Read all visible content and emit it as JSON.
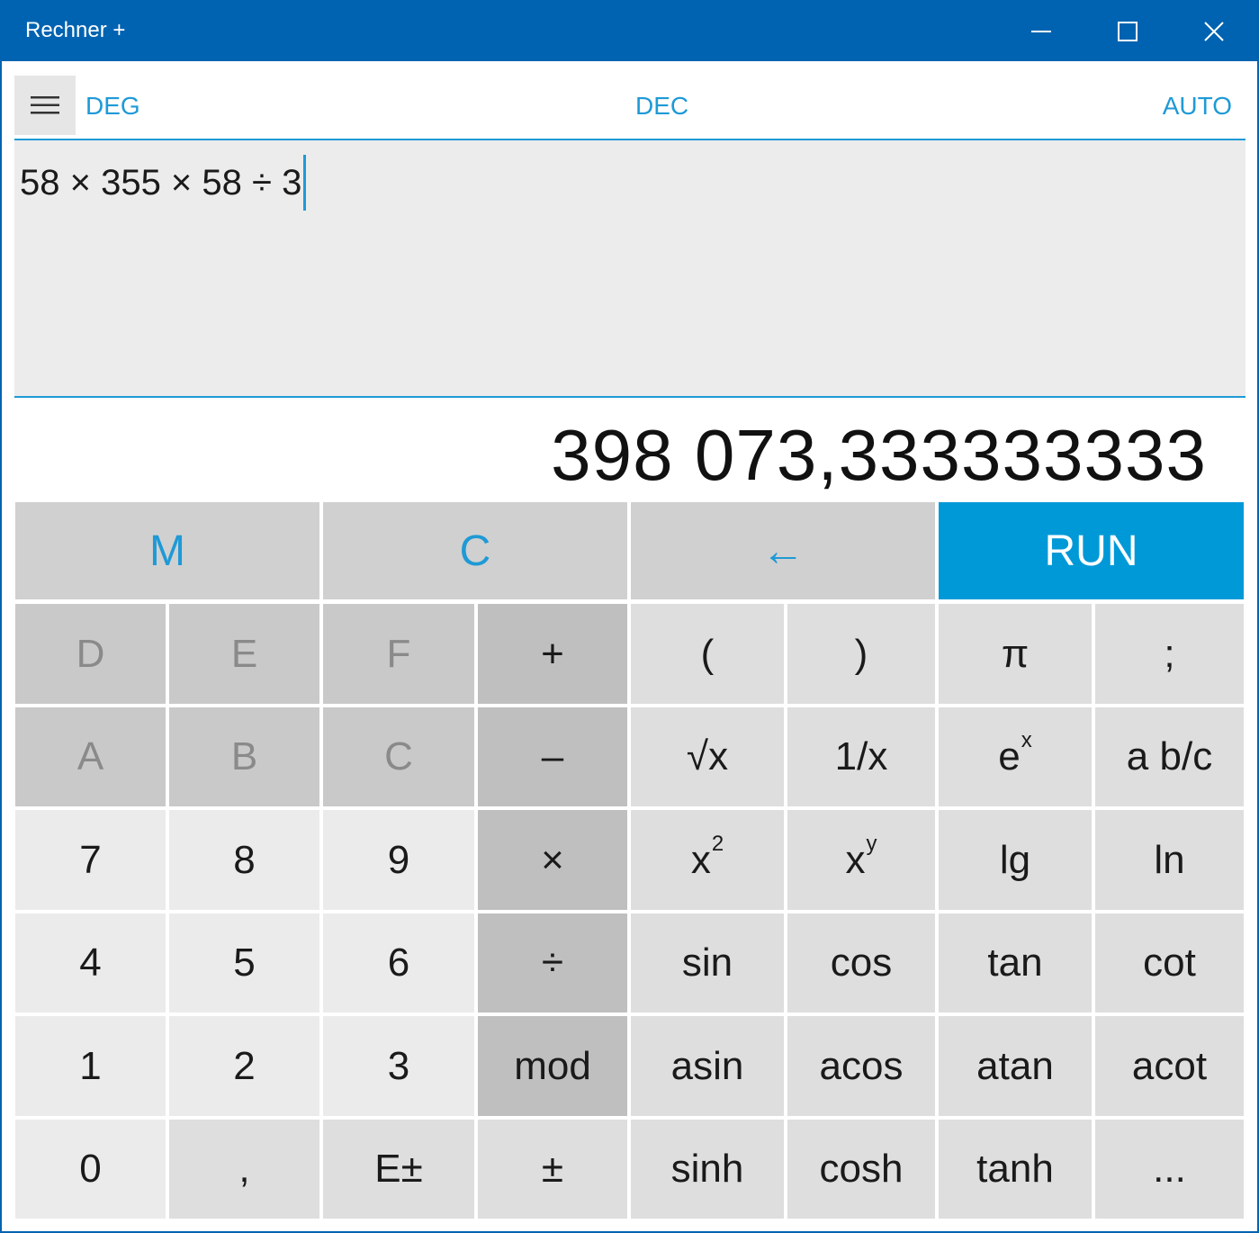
{
  "window": {
    "title": "Rechner +"
  },
  "toolbar": {
    "menu_icon": "hamburger-menu-icon",
    "angle_mode": "DEG",
    "number_base": "DEC",
    "auto_mode": "AUTO"
  },
  "expression": {
    "text": "58 × 355 × 58 ÷ 3"
  },
  "result": {
    "text": "398 073,333333333"
  },
  "colors": {
    "titlebar": "#0063b1",
    "accent": "#1e9ad6",
    "run_button": "#0099d8"
  },
  "top_row": {
    "memory": "M",
    "clear": "C",
    "backspace": "←",
    "run": "RUN"
  },
  "keypad": {
    "row1": [
      "D",
      "E",
      "F",
      "+",
      "(",
      ")",
      "π",
      ";"
    ],
    "row2": [
      "A",
      "B",
      "C",
      "–",
      "√x",
      "1/x",
      "e",
      "a b/c"
    ],
    "row2_sup": {
      "e": "x"
    },
    "row3": [
      "7",
      "8",
      "9",
      "×",
      "x",
      "x",
      "lg",
      "ln"
    ],
    "row3_sup": {
      "x2": "2",
      "xy": "y"
    },
    "row4": [
      "4",
      "5",
      "6",
      "÷",
      "sin",
      "cos",
      "tan",
      "cot"
    ],
    "row5": [
      "1",
      "2",
      "3",
      "mod",
      "asin",
      "acos",
      "atan",
      "acot"
    ],
    "row6": [
      "0",
      ",",
      "E±",
      "±",
      "sinh",
      "cosh",
      "tanh",
      "..."
    ]
  }
}
